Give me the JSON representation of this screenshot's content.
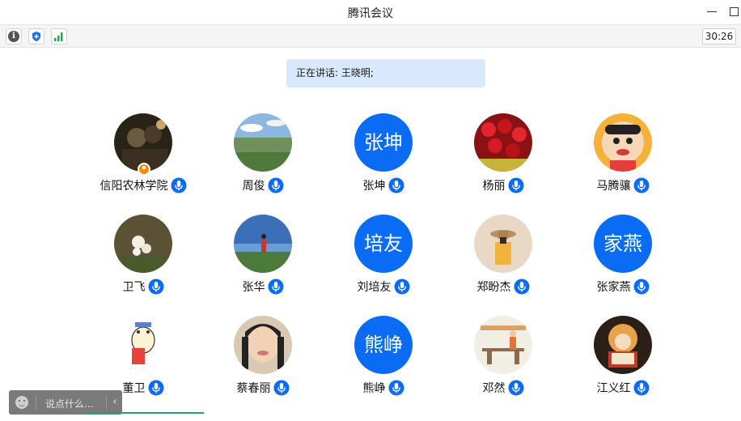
{
  "window": {
    "title": "腾讯会议"
  },
  "toolbar": {
    "icons": [
      "info-icon",
      "security-shield-icon",
      "network-signal-icon"
    ],
    "timer": "30:26"
  },
  "speaker_banner": {
    "text": "正在讲话: 王晓明;"
  },
  "participants": [
    {
      "name": "信阳农林学院",
      "avatar": "photo",
      "host": true
    },
    {
      "name": "周俊",
      "avatar": "photo"
    },
    {
      "name": "张坤",
      "avatar": "text",
      "avatar_text": "张坤"
    },
    {
      "name": "杨丽",
      "avatar": "photo"
    },
    {
      "name": "马腾骧",
      "avatar": "photo"
    },
    {
      "name": "卫飞",
      "avatar": "photo"
    },
    {
      "name": "张华",
      "avatar": "photo"
    },
    {
      "name": "刘培友",
      "avatar": "text",
      "avatar_text": "培友"
    },
    {
      "name": "郑盼杰",
      "avatar": "photo"
    },
    {
      "name": "张家燕",
      "avatar": "text",
      "avatar_text": "家燕"
    },
    {
      "name": "董卫",
      "avatar": "photo"
    },
    {
      "name": "蔡春丽",
      "avatar": "photo"
    },
    {
      "name": "熊峥",
      "avatar": "text",
      "avatar_text": "熊峥"
    },
    {
      "name": "邓然",
      "avatar": "photo"
    },
    {
      "name": "江义红",
      "avatar": "photo"
    }
  ],
  "chat": {
    "placeholder": "说点什么...",
    "collapse_icon": "‹"
  },
  "colors": {
    "accent": "#0a6cf5",
    "banner": "#d9e9fc",
    "host_badge": "#ff8a00",
    "chat_bg": "#7a7a7a"
  }
}
